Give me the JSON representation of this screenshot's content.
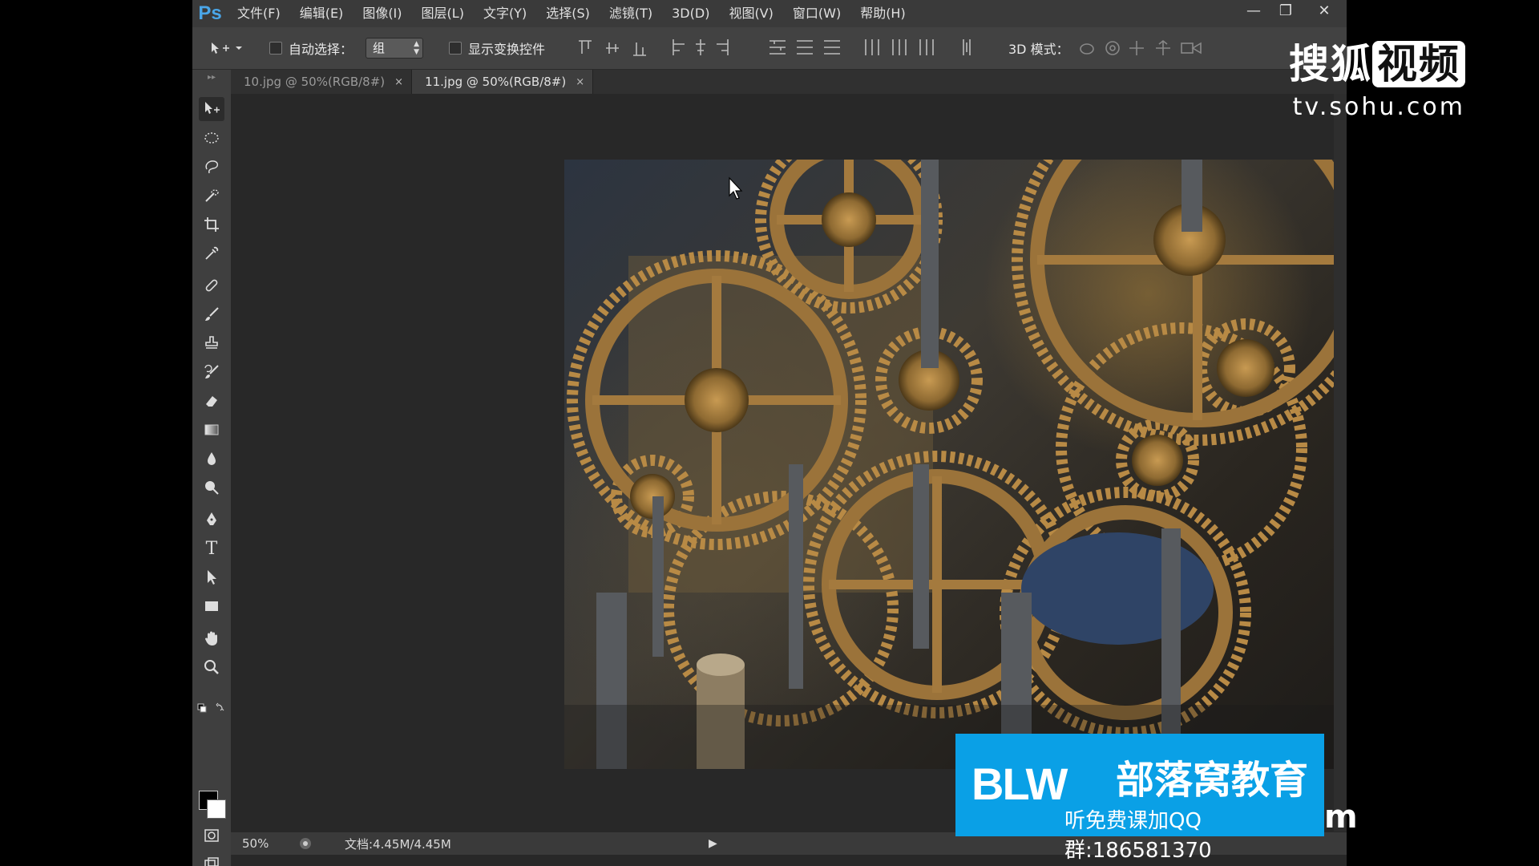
{
  "app": {
    "logo": "Ps",
    "menus": [
      "文件(F)",
      "编辑(E)",
      "图像(I)",
      "图层(L)",
      "文字(Y)",
      "选择(S)",
      "滤镜(T)",
      "3D(D)",
      "视图(V)",
      "窗口(W)",
      "帮助(H)"
    ]
  },
  "window_controls": {
    "minimize": "—",
    "restore": "❐",
    "close": "✕"
  },
  "options": {
    "auto_select_label": "自动选择：",
    "auto_select_value": "组",
    "show_transform_label": "显示变换控件",
    "mode_3d_label": "3D 模式："
  },
  "tabs": [
    {
      "label": "10.jpg @ 50%(RGB/8#)",
      "close": "×",
      "active": false
    },
    {
      "label": "11.jpg @ 50%(RGB/8#)",
      "close": "×",
      "active": true
    }
  ],
  "tools": [
    "move-icon",
    "ellipse-marquee-icon",
    "lasso-icon",
    "quick-select-icon",
    "crop-icon",
    "eyedropper-icon",
    "healing-brush-icon",
    "brush-icon",
    "stamp-icon",
    "history-brush-icon",
    "eraser-icon",
    "gradient-icon",
    "blur-icon",
    "dodge-icon",
    "pen-icon",
    "type-icon",
    "path-select-icon",
    "rectangle-icon",
    "hand-icon",
    "zoom-icon"
  ],
  "tool_text": {
    "type_glyph": "T"
  },
  "colors": {
    "foreground": "#000000",
    "background": "#ffffff",
    "accent_logo": "#4aa6e8"
  },
  "status": {
    "zoom": "50%",
    "doc_info": "文档:4.45M/4.45M"
  },
  "watermark": {
    "sohu_title_a": "搜狐",
    "sohu_title_b": "视频",
    "sohu_url": "tv.sohu.com",
    "blw_logo": "BLW",
    "blw_title": "部落窝教育",
    "blw_sub": "听免费课加QQ群:186581370",
    "blw_tail": "m"
  }
}
